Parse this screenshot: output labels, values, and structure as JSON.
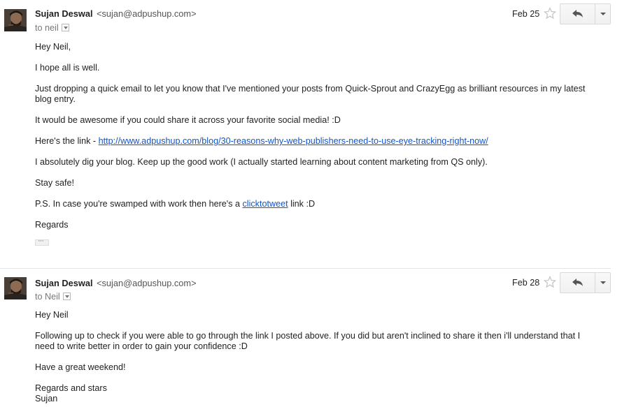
{
  "messages": [
    {
      "sender_name": "Sujan Deswal",
      "sender_email": "<sujan@adpushup.com>",
      "to_prefix": "to ",
      "to_name": "neil",
      "date": "Feb 25",
      "paragraphs": [
        "Hey Neil,",
        "I hope all is well.",
        "Just dropping a quick email to let you know that I've mentioned your posts from Quick-Sprout and CrazyEgg as brilliant resources in my latest blog entry.",
        "It would be awesome if you could share it across your favorite social media! :D"
      ],
      "link_prefix": "Here's the link - ",
      "link_url": "http://www.adpushup.com/blog/30-reasons-why-web-publishers-need-to-use-eye-tracking-right-now/",
      "paragraphs2": [
        "I absolutely dig your blog. Keep up the good work (I actually started learning about content marketing from QS only).",
        "Stay safe!"
      ],
      "ps_prefix": "P.S. In case you're swamped with work then here's a ",
      "ps_link": "clicktotweet",
      "ps_suffix": " link :D",
      "signoff": "Regards"
    },
    {
      "sender_name": "Sujan Deswal",
      "sender_email": "<sujan@adpushup.com>",
      "to_prefix": "to ",
      "to_name": "Neil",
      "date": "Feb 28",
      "paragraphs": [
        "Hey Neil",
        "Following up to check if you were able to go through the link I posted above. If you did but aren't inclined to share it then i'll understand that I need to write better in order to gain your confidence :D",
        "Have a great weekend!"
      ],
      "signoff_line1": "Regards and stars",
      "signoff_line2": "Sujan"
    }
  ],
  "icons": {
    "star": "star-outline-icon",
    "reply": "reply-arrow-icon",
    "more": "caret-down-icon"
  },
  "colors": {
    "link": "#1155cc",
    "muted": "#777777",
    "divider": "#e5e5e5"
  }
}
